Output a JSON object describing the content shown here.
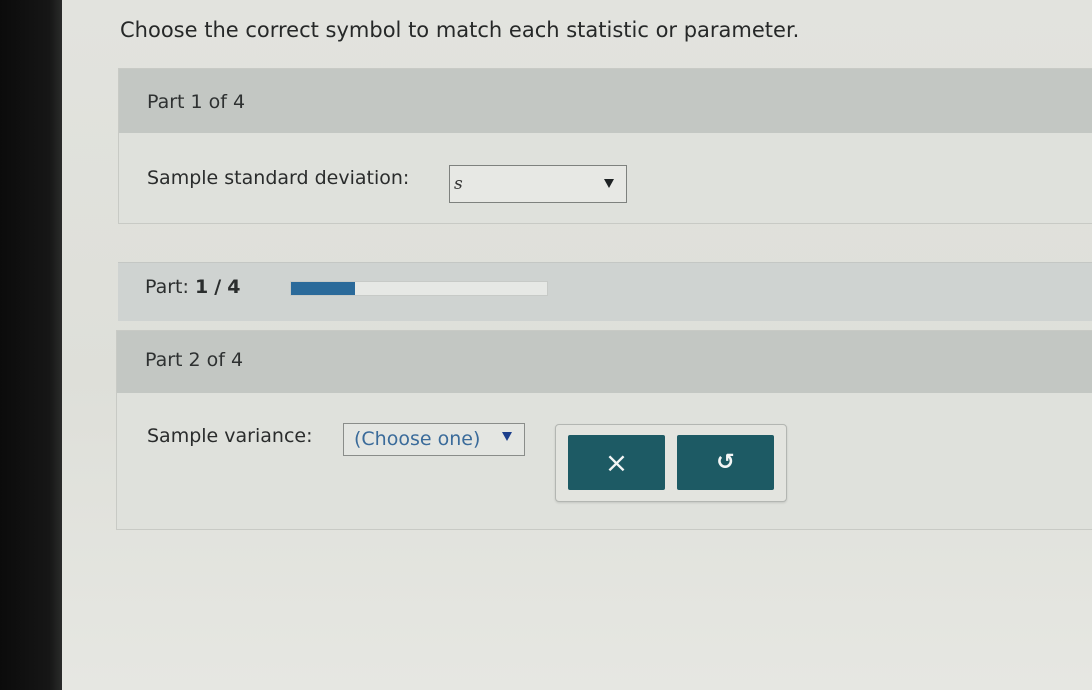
{
  "question": "Choose the correct symbol to match each statistic or parameter.",
  "parts": [
    {
      "header": "Part 1 of 4",
      "prompt": "Sample standard deviation:",
      "selected_value": "s"
    },
    {
      "header": "Part 2 of 4",
      "prompt": "Sample variance:",
      "selected_value": "(Choose one)"
    }
  ],
  "progress": {
    "label": "Part:",
    "current": "1",
    "separator": "/",
    "total": "4",
    "fraction": 0.25
  },
  "actions": {
    "clear_label": "×",
    "undo_label": "↺"
  },
  "colors": {
    "button_bg": "#1d5a64",
    "progress_fill": "#2b6a9a",
    "dropdown_text": "#3a6b9a"
  }
}
